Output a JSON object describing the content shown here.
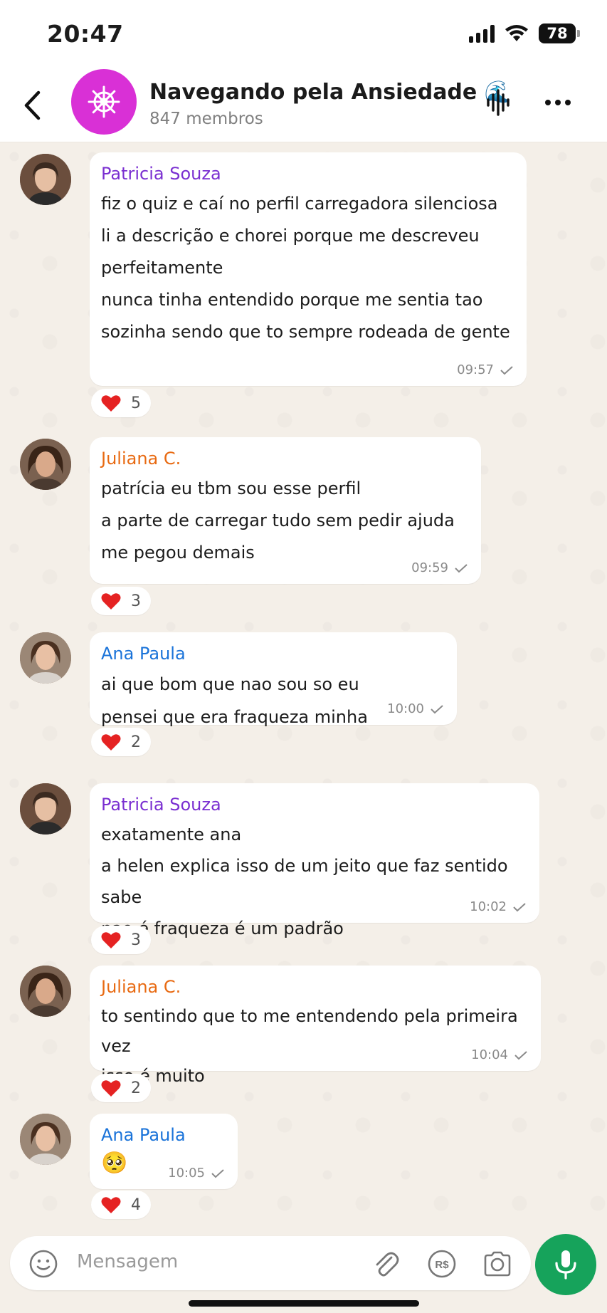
{
  "status_bar": {
    "time": "20:47",
    "battery": "78"
  },
  "header": {
    "title": "Navegando pela Ansiedade 🌊",
    "members": "847 membros"
  },
  "messages": [
    {
      "sender": "Patricia Souza",
      "text": "fiz o quiz e caí no perfil carregadora silenciosa\nli a descrição e chorei porque me descreveu perfeitamente\nnunca tinha entendido porque me sentia tao sozinha sendo que to sempre rodeada de gente",
      "time": "09:57",
      "reaction": "5"
    },
    {
      "sender": "Juliana C.",
      "text": "patrícia eu tbm sou esse perfil\na parte de carregar tudo sem pedir ajuda me pegou demais",
      "time": "09:59",
      "reaction": "3"
    },
    {
      "sender": "Ana Paula",
      "text": "ai que bom que nao sou so eu\npensei que era fraqueza minha",
      "time": "10:00",
      "reaction": "2"
    },
    {
      "sender": "Patricia Souza",
      "text": "exatamente ana\na helen explica isso de um jeito que faz sentido sabe\nnao é fraqueza é um padrão",
      "time": "10:02",
      "reaction": "3"
    },
    {
      "sender": "Juliana C.",
      "text": "to sentindo que to me entendendo pela primeira vez\nisso é muito",
      "time": "10:04",
      "reaction": "2"
    },
    {
      "sender": "Ana Paula",
      "text": "🥺",
      "time": "10:05",
      "reaction": "4"
    }
  ],
  "composer": {
    "placeholder": "Mensagem"
  },
  "colors": {
    "group_avatar": "#d930d6",
    "sender_purple": "#7a2fd1",
    "sender_orange": "#e86a12",
    "sender_blue": "#1a73d9",
    "mic_button": "#16a35b",
    "chat_background": "#f4efe8"
  }
}
